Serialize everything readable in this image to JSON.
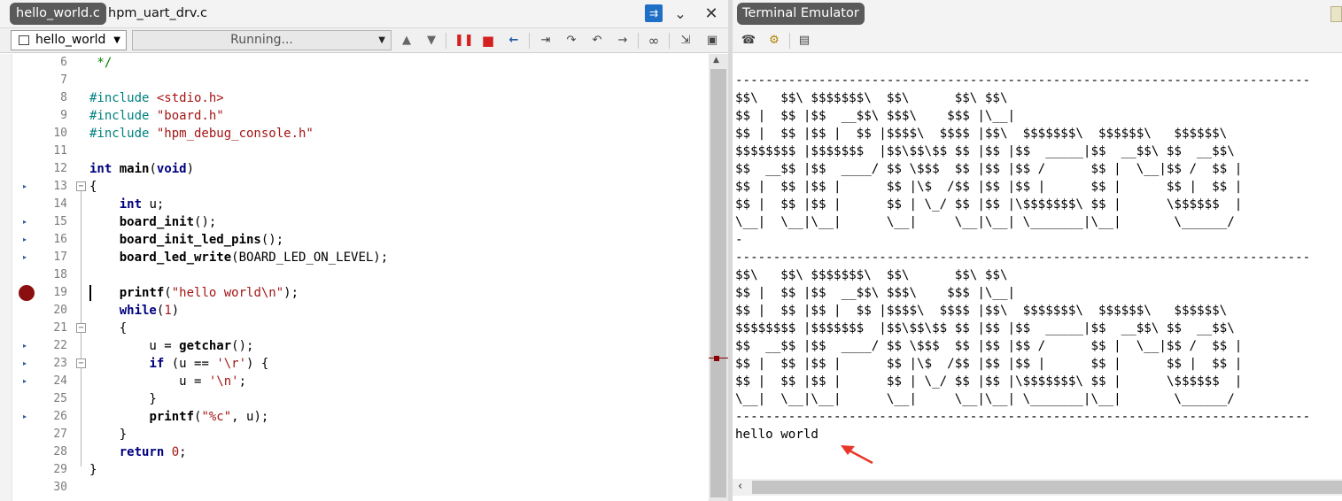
{
  "editor": {
    "tabs": [
      "hello_world.c",
      "hpm_uart_drv.c"
    ],
    "function_select": "hello_world",
    "status": "Running...",
    "lines": [
      {
        "num": "6",
        "indent": "",
        "html": "<span class='cm'> */</span>",
        "marker": false,
        "fold": "",
        "bp": false
      },
      {
        "num": "7",
        "html": "",
        "marker": false,
        "fold": "",
        "bp": false
      },
      {
        "num": "8",
        "html": "<span class='pp'>#include </span><span class='str'>&lt;stdio.h&gt;</span>",
        "marker": false,
        "fold": "",
        "bp": false
      },
      {
        "num": "9",
        "html": "<span class='pp'>#include </span><span class='str'>\"board.h\"</span>",
        "marker": false,
        "fold": "",
        "bp": false
      },
      {
        "num": "10",
        "html": "<span class='pp'>#include </span><span class='str'>\"hpm_debug_console.h\"</span>",
        "marker": false,
        "fold": "",
        "bp": false
      },
      {
        "num": "11",
        "html": "",
        "marker": false,
        "fold": "",
        "bp": false
      },
      {
        "num": "12",
        "html": "<span class='kw'>int</span> <span class='fn'>main</span>(<span class='kw'>void</span>)",
        "marker": false,
        "fold": "",
        "bp": false
      },
      {
        "num": "13",
        "html": "{",
        "marker": true,
        "fold": "−",
        "bp": false
      },
      {
        "num": "14",
        "html": "    <span class='kw'>int</span> u;",
        "marker": false,
        "fold": "",
        "bp": false
      },
      {
        "num": "15",
        "html": "    <span class='fn'>board_init</span>();",
        "marker": true,
        "fold": "",
        "bp": false
      },
      {
        "num": "16",
        "html": "    <span class='fn'>board_init_led_pins</span>();",
        "marker": true,
        "fold": "",
        "bp": false
      },
      {
        "num": "17",
        "html": "    <span class='fn'>board_led_write</span>(BOARD_LED_ON_LEVEL);",
        "marker": true,
        "fold": "",
        "bp": false
      },
      {
        "num": "18",
        "html": "",
        "marker": false,
        "fold": "",
        "bp": false
      },
      {
        "num": "19",
        "html": "    <span class='fn'>printf</span>(<span class='str'>\"hello world\\n\"</span>);",
        "marker": false,
        "fold": "",
        "bp": true
      },
      {
        "num": "20",
        "html": "    <span class='kw'>while</span>(<span class='num'>1</span>)",
        "marker": false,
        "fold": "",
        "bp": false
      },
      {
        "num": "21",
        "html": "    {",
        "marker": false,
        "fold": "−",
        "bp": false
      },
      {
        "num": "22",
        "html": "        u = <span class='fn'>getchar</span>();",
        "marker": true,
        "fold": "",
        "bp": false
      },
      {
        "num": "23",
        "html": "        <span class='kw'>if</span> (u == <span class='str'>'\\r'</span>) {",
        "marker": true,
        "fold": "−",
        "bp": false
      },
      {
        "num": "24",
        "html": "            u = <span class='str'>'\\n'</span>;",
        "marker": true,
        "fold": "",
        "bp": false
      },
      {
        "num": "25",
        "html": "        }",
        "marker": false,
        "fold": "",
        "bp": false
      },
      {
        "num": "26",
        "html": "        <span class='fn'>printf</span>(<span class='str'>\"%c\"</span>, u);",
        "marker": true,
        "fold": "",
        "bp": false
      },
      {
        "num": "27",
        "html": "    }",
        "marker": false,
        "fold": "",
        "bp": false
      },
      {
        "num": "28",
        "html": "    <span class='kw'>return</span> <span class='num'>0</span>;",
        "marker": false,
        "fold": "",
        "bp": false
      },
      {
        "num": "29",
        "html": "}",
        "marker": false,
        "fold": "",
        "bp": false
      },
      {
        "num": "30",
        "html": "",
        "marker": false,
        "fold": "",
        "bp": false
      }
    ]
  },
  "terminal": {
    "title": "Terminal Emulator",
    "lines": [
      "----------------------------------------------------------------------------",
      "$$\\   $$\\ $$$$$$$\\  $$\\      $$\\ $$\\",
      "$$ |  $$ |$$  __$$\\ $$$\\    $$$ |\\__|",
      "$$ |  $$ |$$ |  $$ |$$$$\\  $$$$ |$$\\  $$$$$$$\\  $$$$$$\\   $$$$$$\\",
      "$$$$$$$$ |$$$$$$$  |$$\\$$\\$$ $$ |$$ |$$  _____|$$  __$$\\ $$  __$$\\",
      "$$  __$$ |$$  ____/ $$ \\$$$  $$ |$$ |$$ /      $$ |  \\__|$$ /  $$ |",
      "$$ |  $$ |$$ |      $$ |\\$  /$$ |$$ |$$ |      $$ |      $$ |  $$ |",
      "$$ |  $$ |$$ |      $$ | \\_/ $$ |$$ |\\$$$$$$$\\ $$ |      \\$$$$$$  |",
      "\\__|  \\__|\\__|      \\__|     \\__|\\__| \\_______|\\__|       \\______/",
      "-",
      "----------------------------------------------------------------------------",
      "$$\\   $$\\ $$$$$$$\\  $$\\      $$\\ $$\\",
      "$$ |  $$ |$$  __$$\\ $$$\\    $$$ |\\__|",
      "$$ |  $$ |$$ |  $$ |$$$$\\  $$$$ |$$\\  $$$$$$$\\  $$$$$$\\   $$$$$$\\",
      "$$$$$$$$ |$$$$$$$  |$$\\$$\\$$ $$ |$$ |$$  _____|$$  __$$\\ $$  __$$\\",
      "$$  __$$ |$$  ____/ $$ \\$$$  $$ |$$ |$$ /      $$ |  \\__|$$ /  $$ |",
      "$$ |  $$ |$$ |      $$ |\\$  /$$ |$$ |$$ |      $$ |      $$ |  $$ |",
      "$$ |  $$ |$$ |      $$ | \\_/ $$ |$$ |\\$$$$$$$\\ $$ |      \\$$$$$$  |",
      "\\__|  \\__|\\__|      \\__|     \\__|\\__| \\_______|\\__|       \\______/",
      "----------------------------------------------------------------------------",
      "hello world"
    ]
  },
  "colors": {
    "tab_active_bg": "#5a5a5a",
    "breakpoint": "#8b0f0f",
    "keyword": "#000080",
    "preprocessor": "#008080",
    "string": "#a31515",
    "annotation_arrow": "#e8372a"
  },
  "icons": {
    "editor_tab_bar": [
      "window-list-icon",
      "chevron-down-icon",
      "close-icon"
    ],
    "debug_toolbar": [
      "step-up-icon",
      "step-down-icon",
      "pause-icon",
      "stop-icon",
      "restart-icon",
      "step-into-icon",
      "step-over-icon",
      "step-out-icon",
      "run-to-cursor-icon",
      "watch-icon",
      "disassembly-icon",
      "memory-icon"
    ],
    "terminal_toolbar": [
      "connect-icon",
      "settings-icon",
      "properties-icon"
    ]
  }
}
